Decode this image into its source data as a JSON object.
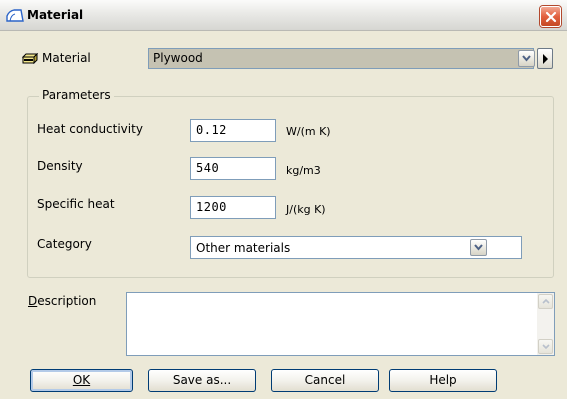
{
  "window": {
    "title": "Material",
    "title_icon": "material-shape-icon",
    "close_icon": "close-icon"
  },
  "material": {
    "label": "Material",
    "icon": "material-block-icon",
    "selected": "Plywood"
  },
  "parameters": {
    "legend": "Parameters",
    "rows": [
      {
        "label": "Heat conductivity",
        "value": "0.12",
        "unit": "W/(m K)"
      },
      {
        "label": "Density",
        "value": "540",
        "unit": "kg/m3"
      },
      {
        "label": "Specific heat",
        "value": "1200",
        "unit": "J/(kg K)"
      }
    ],
    "category_label": "Category",
    "category_value": "Other materials"
  },
  "description": {
    "label": "Description",
    "value": ""
  },
  "buttons": {
    "ok": "OK",
    "save_as": "Save as...",
    "cancel": "Cancel",
    "help": "Help"
  },
  "colors": {
    "dialog_bg": "#ece9d8",
    "field_border": "#7f9db9",
    "close_red": "#e2603f"
  }
}
